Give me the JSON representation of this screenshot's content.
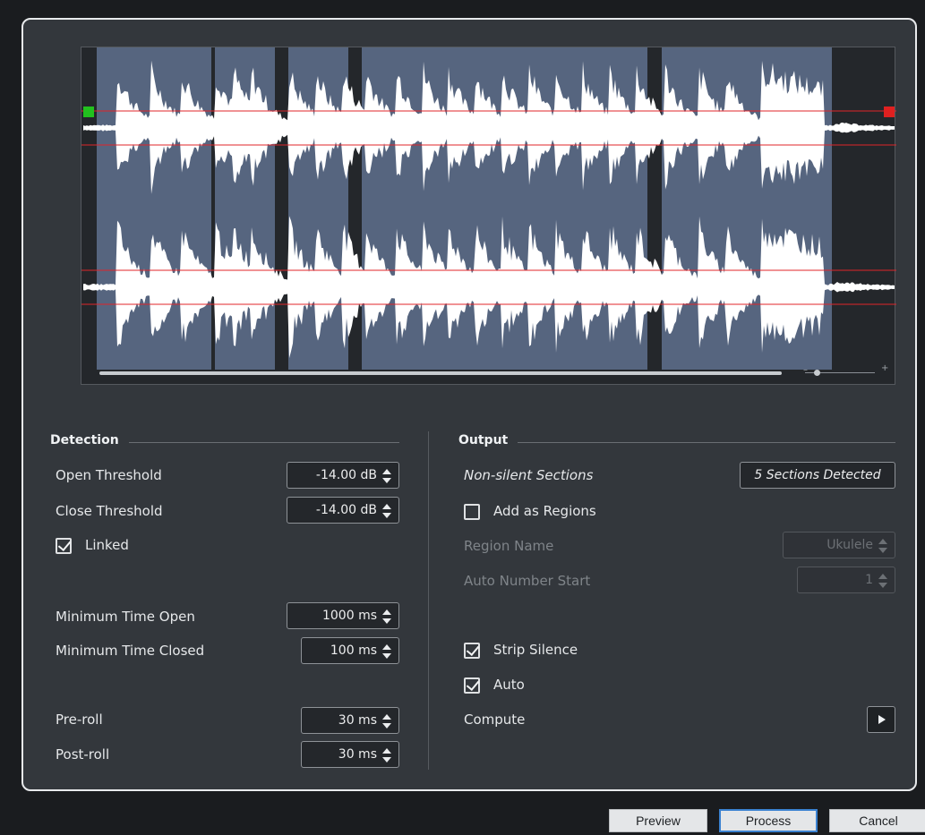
{
  "waveform": {
    "sections_count": 5,
    "threshold_line_color": "#e0242a",
    "section_fill_color": "#56657f",
    "open_marker_color": "#22c11e",
    "close_marker_color": "#e02020"
  },
  "detection": {
    "title": "Detection",
    "open_threshold_label": "Open Threshold",
    "open_threshold_value": "-14.00 dB",
    "close_threshold_label": "Close Threshold",
    "close_threshold_value": "-14.00 dB",
    "linked_label": "Linked",
    "linked_checked": true,
    "min_time_open_label": "Minimum Time Open",
    "min_time_open_value": "1000 ms",
    "min_time_closed_label": "Minimum Time Closed",
    "min_time_closed_value": "100 ms",
    "preroll_label": "Pre-roll",
    "preroll_value": "30 ms",
    "postroll_label": "Post-roll",
    "postroll_value": "30 ms"
  },
  "output": {
    "title": "Output",
    "non_silent_label": "Non-silent Sections",
    "sections_detected": "5 Sections Detected",
    "add_regions_label": "Add as Regions",
    "add_regions_checked": false,
    "region_name_label": "Region Name",
    "region_name_value": "Ukulele",
    "auto_number_label": "Auto Number Start",
    "auto_number_value": "1",
    "strip_silence_label": "Strip Silence",
    "strip_silence_checked": true,
    "auto_label": "Auto",
    "auto_checked": true,
    "compute_label": "Compute"
  },
  "buttons": {
    "preview": "Preview",
    "process": "Process",
    "cancel": "Cancel"
  }
}
